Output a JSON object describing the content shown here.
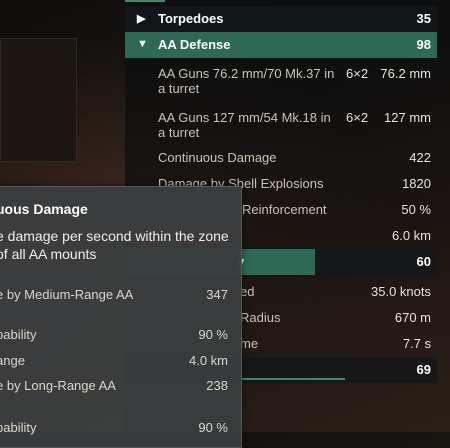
{
  "sections": {
    "torpedoes": {
      "label": "Torpedoes",
      "value": "35"
    },
    "aa_defense": {
      "label": "AA Defense",
      "value": "98"
    },
    "maneuverability_value": "60",
    "concealment_value": "69"
  },
  "aa_guns": [
    {
      "name": "AA Guns 76.2 mm/70 Mk.37 in a turret",
      "count": "6×2",
      "caliber": "76.2 mm"
    },
    {
      "name": "AA Guns 127 mm/54 Mk.18 in a turret",
      "count": "6×2",
      "caliber": "127 mm"
    }
  ],
  "aa_stats": {
    "continuous_damage": {
      "label": "Continuous Damage",
      "value": "422"
    },
    "shell_explosions": {
      "label": "Damage by Shell Explosions",
      "value": "1820"
    },
    "reinforcement": {
      "label": "Reinforcement",
      "value": "50 %"
    },
    "range_value": "6.0 km"
  },
  "maneuver_stats": {
    "speed": {
      "label": "ed",
      "value": "35.0 knots"
    },
    "radius": {
      "label": "Radius",
      "value": "670 m"
    },
    "time": {
      "label": "me",
      "value": "7.7 s"
    }
  },
  "tooltip": {
    "title": "uous Damage",
    "description": "e damage per second within the zone of all AA mounts",
    "rows": [
      {
        "label": "e by Medium-Range AA",
        "value": "347"
      },
      {
        "label": "pability",
        "value": "90 %"
      },
      {
        "label": "ange",
        "value": "4.0 km"
      },
      {
        "label": "e by Long-Range AA",
        "value": "238"
      },
      {
        "label": "pability",
        "value": "90 %"
      }
    ]
  },
  "colors": {
    "accent": "#2c6a55",
    "bar": "#3b8b6f",
    "tooltip_bg": "#3a3d3e"
  }
}
